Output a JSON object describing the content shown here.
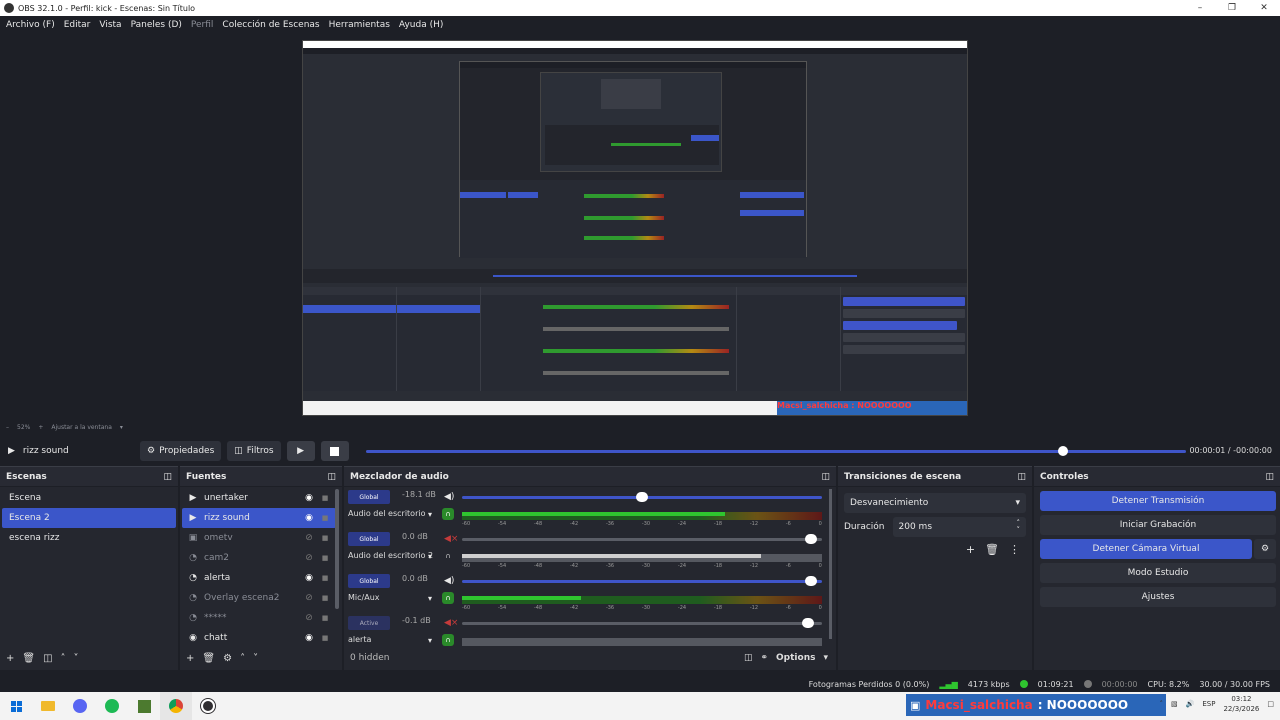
{
  "window": {
    "title": "OBS 32.1.0 - Perfil: kick - Escenas: Sin Título"
  },
  "menu": [
    {
      "label": "Archivo (F)",
      "dim": false
    },
    {
      "label": "Editar",
      "dim": false
    },
    {
      "label": "Vista",
      "dim": false
    },
    {
      "label": "Paneles (D)",
      "dim": false
    },
    {
      "label": "Perfil",
      "dim": true
    },
    {
      "label": "Colección de Escenas",
      "dim": false
    },
    {
      "label": "Herramientas",
      "dim": false
    },
    {
      "label": "Ayuda (H)",
      "dim": false
    }
  ],
  "preview": {
    "nested_ticker": "Macsi_salchicha : NOOOOOOO",
    "zoom": "52%",
    "fit_label": "Ajustar a la ventana"
  },
  "toolbar": {
    "source_name": "rizz sound",
    "properties_label": "Propiedades",
    "filters_label": "Filtros",
    "seek_fraction": 0.85,
    "time_current": "00:00:01",
    "time_separator": "/",
    "time_remaining": "-00:00:00"
  },
  "scenes": {
    "title": "Escenas",
    "items": [
      {
        "label": "Escena",
        "selected": false
      },
      {
        "label": "Escena 2",
        "selected": true
      },
      {
        "label": "escena rizz",
        "selected": false
      }
    ]
  },
  "sources": {
    "title": "Fuentes",
    "items": [
      {
        "label": "unertaker",
        "icon": "play-icon",
        "visible": true,
        "selected": false
      },
      {
        "label": "rizz sound",
        "icon": "play-icon",
        "visible": true,
        "selected": true
      },
      {
        "label": "ometv",
        "icon": "window-capture-icon",
        "visible": false,
        "selected": false
      },
      {
        "label": "cam2",
        "icon": "browser-icon",
        "visible": false,
        "selected": false
      },
      {
        "label": "alerta",
        "icon": "browser-icon",
        "visible": true,
        "selected": false
      },
      {
        "label": "Overlay escena2",
        "icon": "browser-icon",
        "visible": false,
        "selected": false
      },
      {
        "label": "*****",
        "icon": "browser-icon",
        "visible": false,
        "selected": false
      },
      {
        "label": "chatt",
        "icon": "camera-icon",
        "visible": true,
        "selected": false
      }
    ]
  },
  "mixer": {
    "title": "Mezclador de audio",
    "hidden_label": "0 hidden",
    "options_label": "Options",
    "ticks": [
      "-60",
      "-54",
      "-48",
      "-42",
      "-36",
      "-30",
      "-24",
      "-18",
      "-12",
      "-6",
      "0"
    ],
    "channels": [
      {
        "tag": "Global",
        "db": "-18.1 dB",
        "name": "Audio del escritorio",
        "muted": false,
        "monitor": true,
        "vol": 0.5,
        "level": 0.73,
        "grey": false
      },
      {
        "tag": "Global",
        "db": "0.0 dB",
        "name": "Audio del escritorio 2",
        "muted": true,
        "monitor": false,
        "vol": 0.97,
        "level": 0.83,
        "grey": true
      },
      {
        "tag": "Global",
        "db": "0.0 dB",
        "name": "Mic/Aux",
        "muted": false,
        "monitor": true,
        "vol": 0.97,
        "level": 0.33,
        "grey": false
      },
      {
        "tag": "Active",
        "db": "-0.1 dB",
        "name": "alerta",
        "muted": true,
        "monitor": true,
        "vol": 0.96,
        "level": 0.0,
        "grey": true
      }
    ]
  },
  "transitions": {
    "title": "Transiciones de escena",
    "selected": "Desvanecimiento",
    "duration_label": "Duración",
    "duration_value": "200 ms"
  },
  "controls": {
    "title": "Controles",
    "stop_stream": "Detener Transmisión",
    "start_record": "Iniciar Grabación",
    "stop_virtualcam": "Detener Cámara Virtual",
    "studio_mode": "Modo Estudio",
    "settings": "Ajustes"
  },
  "status": {
    "dropped": "Fotogramas Perdidos 0 (0.0%)",
    "bitrate": "4173 kbps",
    "stream_time": "01:09:21",
    "rec_time": "00:00:00",
    "cpu": "CPU: 8.2%",
    "fps": "30.00 / 30.00 FPS"
  },
  "taskbar": {
    "ticker_user": "Macsi_salchicha",
    "ticker_msg": ": NOOOOOOO",
    "lang": "ESP",
    "time": "03:12",
    "date": "22/3/2026"
  },
  "colors": {
    "accent": "#3b56c9",
    "bg": "#1d1f26",
    "panel": "#25272f",
    "ticker": "#2a66b8",
    "ticker_user": "#ff3b3b"
  }
}
